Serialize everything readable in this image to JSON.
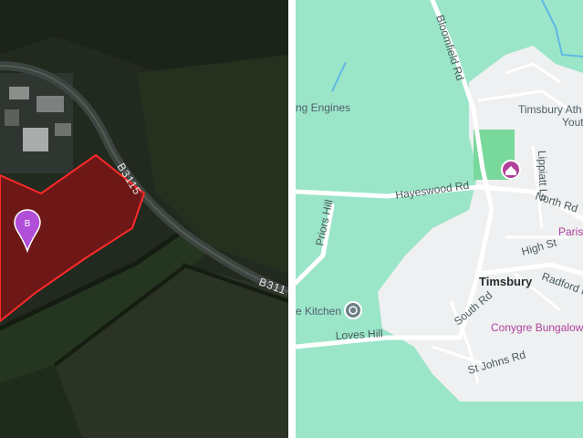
{
  "satellite": {
    "marker": {
      "letter": "B"
    },
    "road_labels": {
      "b3115_upper": "B3115",
      "b3115_lower": "B311"
    },
    "colors": {
      "field_dark": "#1f2a1d",
      "field_mid": "#2c3a28",
      "plot_fill": "#7a1515",
      "plot_border": "#ff2a2a",
      "marker": "#b14fd8"
    }
  },
  "map": {
    "roads": {
      "bloomfield": "Bloomfield Rd",
      "hayeswood": "Hayeswood Rd",
      "north": "North Rd",
      "lippiatt": "Lippiatt Ln",
      "priors": "Priors Hill",
      "high": "High St",
      "radford": "Radford Hill",
      "south": "South Rd",
      "loves": "Loves Hill",
      "st_johns": "St Johns Rd"
    },
    "places": {
      "engines": "ng Engines",
      "athletic": "Timsbury Ath",
      "youth": "Yout",
      "parish": "Paris",
      "town": "Timsbury",
      "kitchen": "e Kitchen",
      "conygre": "Conygre Bungalow"
    },
    "icons": {
      "park": "home-icon",
      "restaurant": "restaurant-icon"
    },
    "colors": {
      "background": "#9be5c9",
      "urban": "#eef0f1",
      "road": "#ffffff",
      "park": "#79d89b",
      "poi": "#b0409a",
      "water": "#5fb8e5"
    }
  }
}
